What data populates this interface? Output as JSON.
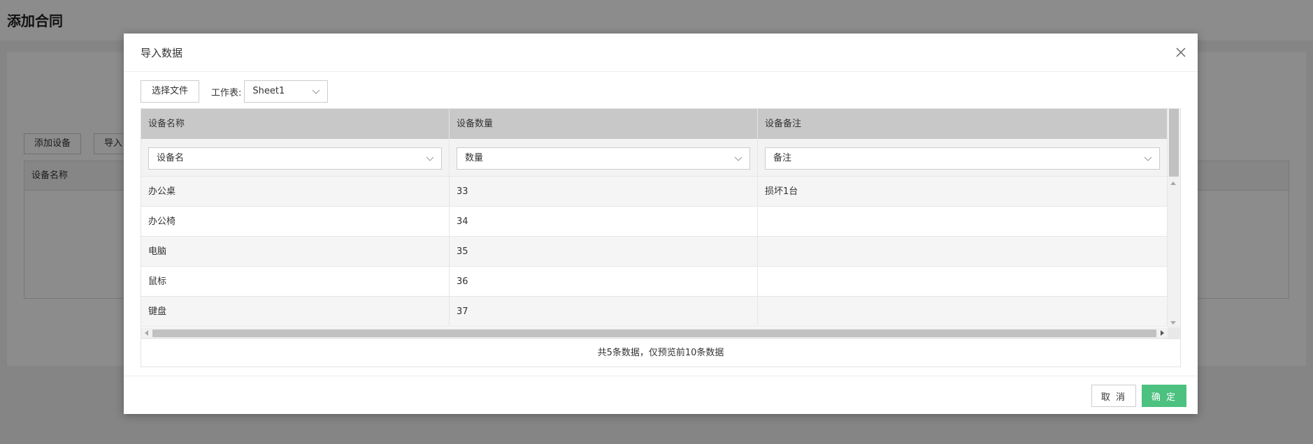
{
  "background": {
    "page_title": "添加合同",
    "add_device_label": "添加设备",
    "import_label": "导入",
    "table_header": "设备名称"
  },
  "modal": {
    "title": "导入数据",
    "choose_file_label": "选择文件",
    "sheet_label": "工作表:",
    "sheet_value": "Sheet1",
    "columns": [
      "设备名称",
      "设备数量",
      "设备备注"
    ],
    "mappings": [
      "设备名",
      "数量",
      "备注"
    ],
    "rows": [
      [
        "办公桌",
        "33",
        "损坏1台"
      ],
      [
        "办公椅",
        "34",
        ""
      ],
      [
        "电脑",
        "35",
        ""
      ],
      [
        "鼠标",
        "36",
        ""
      ],
      [
        "键盘",
        "37",
        ""
      ]
    ],
    "summary": "共5条数据，仅预览前10条数据",
    "cancel_label": "取 消",
    "ok_label": "确 定"
  },
  "colors": {
    "primary": "#4cc180",
    "header_bg": "#c8c8c8",
    "overlay": "rgba(0,0,0,0.45)"
  }
}
